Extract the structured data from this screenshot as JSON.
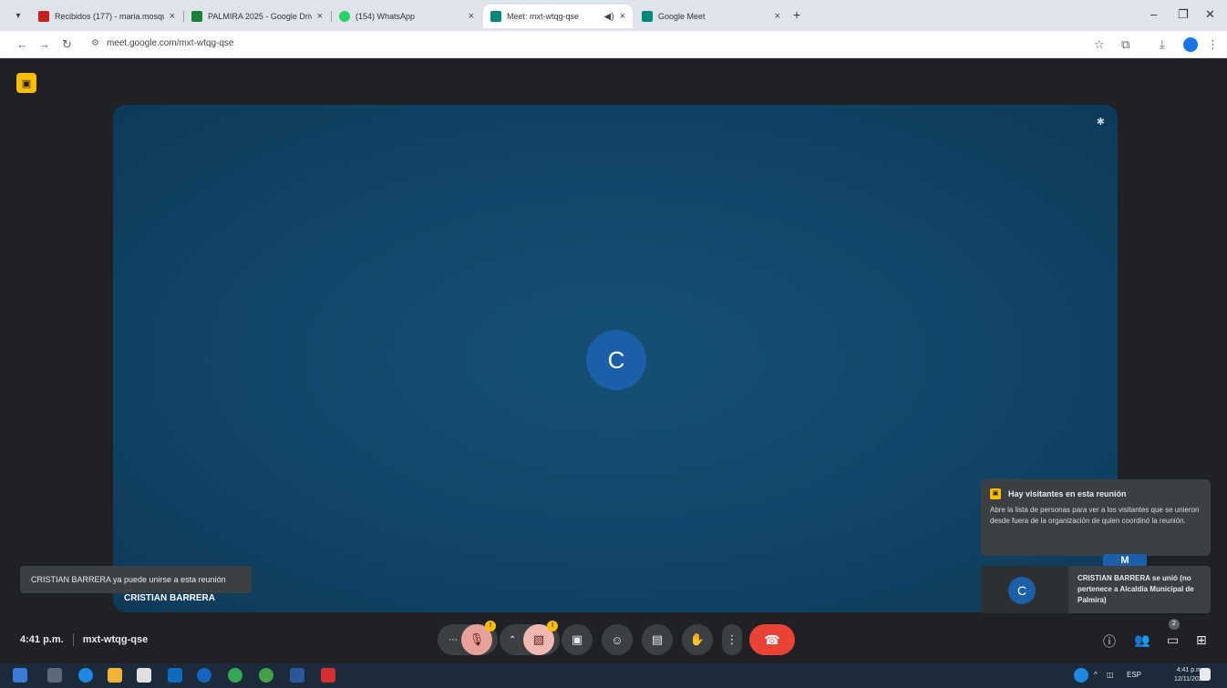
{
  "browser": {
    "tabs": [
      {
        "label": "Recibidos (177) - maria.mosqu",
        "favicon_color": "#c5221f",
        "active": false
      },
      {
        "label": "PALMIRA 2025 - Google Drive",
        "favicon_color": "#188038",
        "active": false
      },
      {
        "label": "(154) WhatsApp",
        "favicon_color": "#25d366",
        "active": false
      },
      {
        "label": "Meet: mxt-wtqg-qse",
        "favicon_color": "#00897b",
        "active": true
      },
      {
        "label": "Google Meet",
        "favicon_color": "#00897b",
        "active": false
      }
    ],
    "url": "meet.google.com/mxt-wtqg-qse"
  },
  "meet": {
    "participant_initial": "C",
    "participant_name": "CRISTIAN BARRERA",
    "toast_left": "CRISTIAN BARRERA ya puede unirse a esta reunión",
    "visitors_title": "Hay visitantes en esta reunión",
    "visitors_body": "Abre la lista de personas para ver a los visitantes que se unieron desde fuera de la organización de quien coordinó la reunión.",
    "mini_tile_initial": "M",
    "join_initial": "C",
    "join_text": "CRISTIAN BARRERA se unió (no pertenece a Alcaldía Municipal de Palmira)",
    "time": "4:41 p.m.",
    "meeting_code": "mxt-wtqg-qse",
    "people_count": "2",
    "mic_badge": "!",
    "cam_badge": "!"
  },
  "taskbar": {
    "lang": "ESP",
    "clock_time": "4:41 p.m.",
    "clock_date": "12/11/2025"
  },
  "colors": {
    "tile_bg": "#124568",
    "avatar": "#1a5fa7",
    "hangup": "#ea4335",
    "mic_muted": "#e8a19a",
    "cam_off": "#f0b8b2",
    "warning": "#fbbc04"
  }
}
